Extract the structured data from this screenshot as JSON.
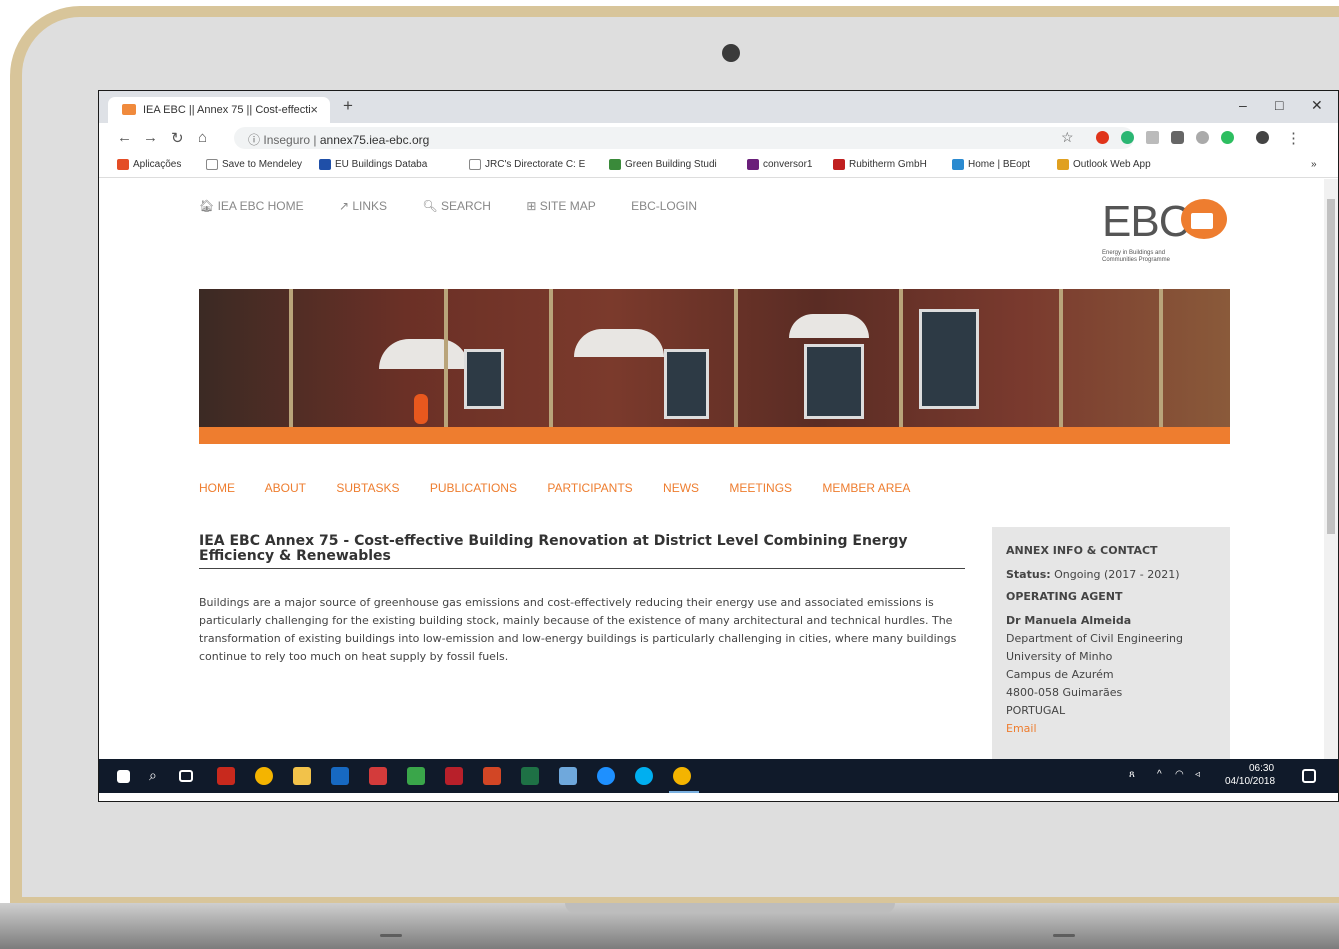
{
  "browser": {
    "tab_title": "IEA EBC || Annex 75 || Cost-effecti",
    "tab_close": "×",
    "new_tab": "+",
    "minimize": "–",
    "restore": "□",
    "close": "✕",
    "url_security": "Inseguro",
    "url_separator": "|",
    "url": "annex75.iea-ebc.org",
    "more_menu": "⋮",
    "bookmarks": [
      {
        "label": "Aplicações",
        "color": "#e44d26"
      },
      {
        "label": "Save to Mendeley",
        "color": "#888888"
      },
      {
        "label": "EU Buildings Databa",
        "color": "#1f4fa8"
      },
      {
        "label": "JRC's Directorate C: E",
        "color": "#888888"
      },
      {
        "label": "Green Building Studi",
        "color": "#3a8a3a"
      },
      {
        "label": "conversor1",
        "color": "#6a1f7a"
      },
      {
        "label": "Rubitherm GmbH",
        "color": "#c01f1f"
      },
      {
        "label": "Home | BEopt",
        "color": "#2a8ad0"
      },
      {
        "label": "Outlook Web App",
        "color": "#e0a020"
      }
    ],
    "bookmarks_more": "»"
  },
  "site": {
    "topnav": [
      "IEA EBC HOME",
      "LINKS",
      "SEARCH",
      "SITE MAP",
      "EBC-LOGIN"
    ],
    "logo_text": "EBC",
    "logo_subtitle": "Energy in Buildings and Communities Programme",
    "mainnav": [
      "HOME",
      "ABOUT",
      "SUBTASKS",
      "PUBLICATIONS",
      "PARTICIPANTS",
      "NEWS",
      "MEETINGS",
      "MEMBER AREA"
    ],
    "title": "IEA EBC Annex 75 - Cost-effective Building Renovation at District Level Combining Energy Efficiency & Renewables",
    "intro": "Buildings are a major source of greenhouse gas emissions and cost-effectively reducing their energy use and associated emissions is particularly challenging for the existing building stock, mainly because of the existence of many architectural and technical hurdles. The transformation of existing buildings into low-emission and low-energy buildings is particularly challenging in cities, where many buildings continue to rely too much on heat supply by fossil fuels.",
    "sidebar": {
      "heading": "ANNEX INFO & CONTACT",
      "status_label": "Status:",
      "status_value": "Ongoing (2017 - 2021)",
      "agent_heading": "OPERATING AGENT",
      "agent_name": "Dr Manuela Almeida",
      "address": [
        "Department of Civil Engineering",
        "University of Minho",
        "Campus de Azurém",
        "4800-058 Guimarães",
        "PORTUGAL"
      ],
      "email": "Email"
    }
  },
  "taskbar": {
    "time": "06:30",
    "date": "04/10/2018",
    "accent": "#101a2a"
  }
}
